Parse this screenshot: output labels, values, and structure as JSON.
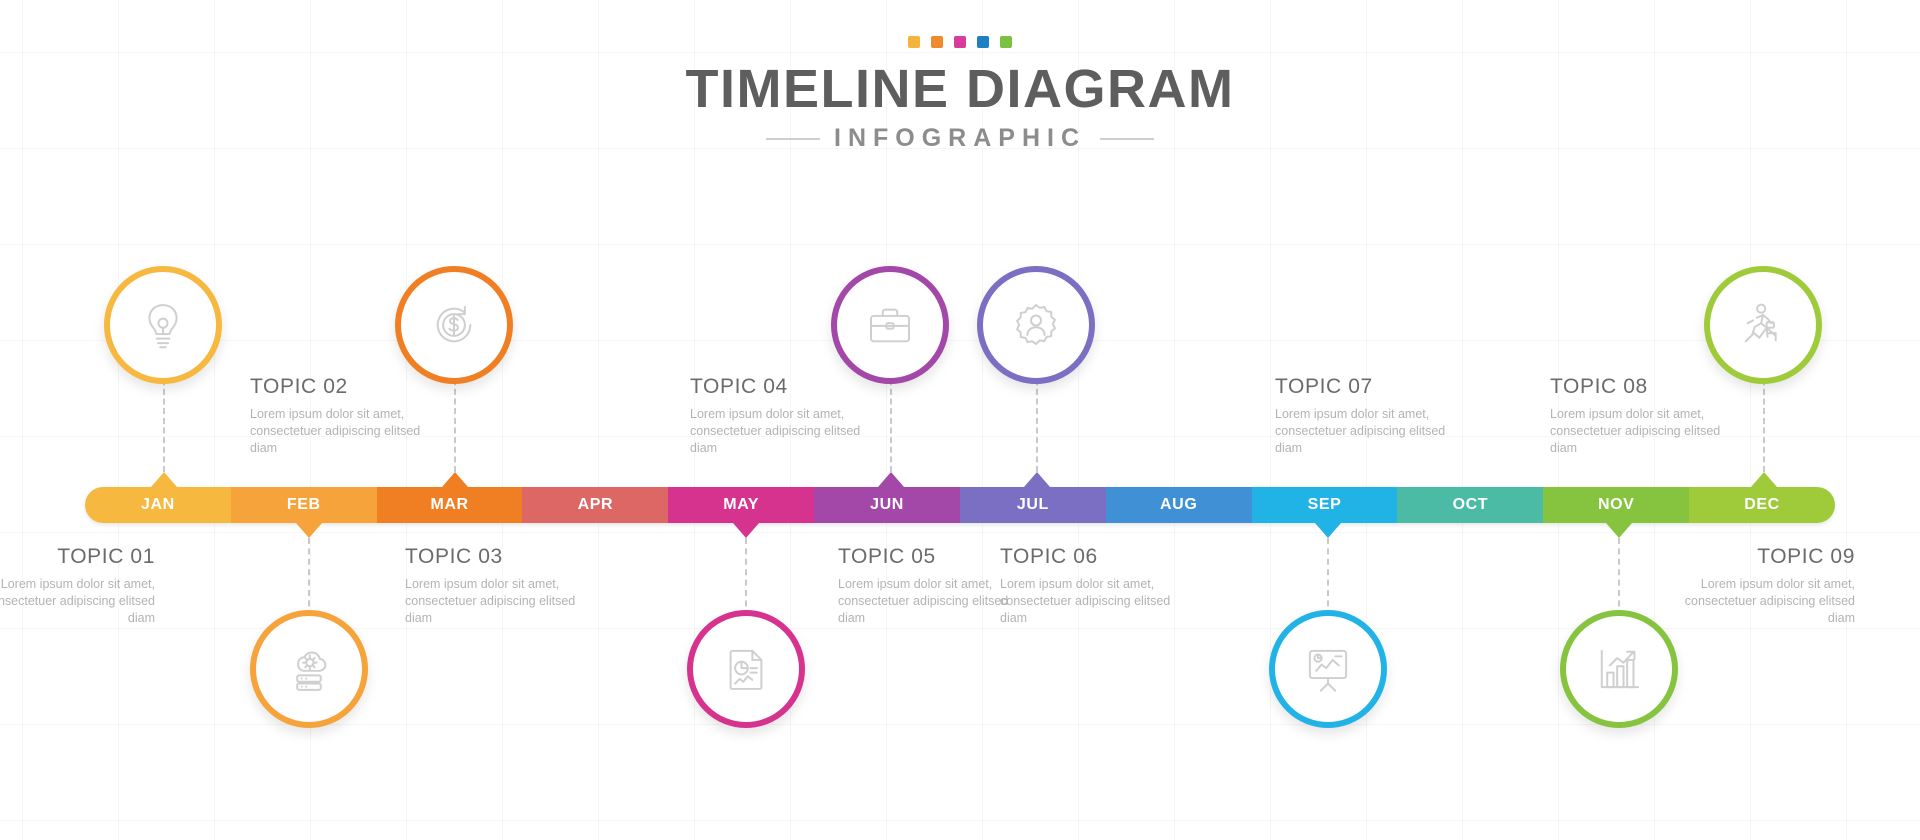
{
  "header": {
    "title": "TIMELINE DIAGRAM",
    "subtitle": "INFOGRAPHIC",
    "dots": [
      "#f5b53c",
      "#f08a2e",
      "#d83c9b",
      "#1f7fc4",
      "#7cc242"
    ]
  },
  "months": [
    {
      "label": "JAN",
      "color": "#f6b83f"
    },
    {
      "label": "FEB",
      "color": "#f5a33a"
    },
    {
      "label": "MAR",
      "color": "#f07f23"
    },
    {
      "label": "APR",
      "color": "#dd6765"
    },
    {
      "label": "MAY",
      "color": "#d6338f"
    },
    {
      "label": "JUN",
      "color": "#a champion"
    },
    {
      "label": "JUL",
      "color": "#7b6fc4"
    },
    {
      "label": "AUG",
      "color": "#3f90d4"
    },
    {
      "label": "SEP",
      "color": "#22b3e6"
    },
    {
      "label": "OCT",
      "color": "#4bbba6"
    },
    {
      "label": "NOV",
      "color": "#86c440"
    },
    {
      "label": "DEC",
      "color": "#9fcb3b"
    }
  ],
  "topics": [
    {
      "id": "topic-01",
      "title": "TOPIC 01",
      "desc": "Lorem ipsum dolor sit amet, consectetuer adipiscing elitsed diam"
    },
    {
      "id": "topic-02",
      "title": "TOPIC 02",
      "desc": "Lorem ipsum dolor sit amet, consectetuer adipiscing elitsed diam"
    },
    {
      "id": "topic-03",
      "title": "TOPIC 03",
      "desc": "Lorem ipsum dolor sit amet, consectetuer adipiscing elitsed diam"
    },
    {
      "id": "topic-04",
      "title": "TOPIC 04",
      "desc": "Lorem ipsum dolor sit amet, consectetuer adipiscing elitsed diam"
    },
    {
      "id": "topic-05",
      "title": "TOPIC 05",
      "desc": "Lorem ipsum dolor sit amet, consectetuer adipiscing elitsed diam"
    },
    {
      "id": "topic-06",
      "title": "TOPIC 06",
      "desc": "Lorem ipsum dolor sit amet, consectetuer adipiscing elitsed diam"
    },
    {
      "id": "topic-07",
      "title": "TOPIC 07",
      "desc": "Lorem ipsum dolor sit amet, consectetuer adipiscing elitsed diam"
    },
    {
      "id": "topic-08",
      "title": "TOPIC 08",
      "desc": "Lorem ipsum dolor sit amet, consectetuer adipiscing elitsed diam"
    },
    {
      "id": "topic-09",
      "title": "TOPIC 09",
      "desc": "Lorem ipsum dolor sit amet, consectetuer adipiscing elitsed diam"
    }
  ],
  "nodes": [
    {
      "id": "node-01",
      "icon": "lightbulb-idea-icon",
      "color": "#f6b83f",
      "month": "JAN"
    },
    {
      "id": "node-02",
      "icon": "cloud-server-settings-icon",
      "color": "#f5a33a",
      "month": "FEB"
    },
    {
      "id": "node-03",
      "icon": "money-growth-icon",
      "color": "#f07f23",
      "month": "MAR"
    },
    {
      "id": "node-04",
      "icon": "document-chart-icon",
      "color": "#d6338f",
      "month": "MAY"
    },
    {
      "id": "node-05",
      "icon": "briefcase-icon",
      "color": "#a347a8",
      "month": "JUN"
    },
    {
      "id": "node-06",
      "icon": "gear-person-icon",
      "color": "#7b6fc4",
      "month": "JUL"
    },
    {
      "id": "node-07",
      "icon": "presentation-board-icon",
      "color": "#22b3e6",
      "month": "SEP"
    },
    {
      "id": "node-08",
      "icon": "bar-chart-growth-icon",
      "color": "#86c440",
      "month": "NOV"
    },
    {
      "id": "node-09",
      "icon": "businessman-running-icon",
      "color": "#9fcb3b",
      "month": "DEC"
    }
  ]
}
